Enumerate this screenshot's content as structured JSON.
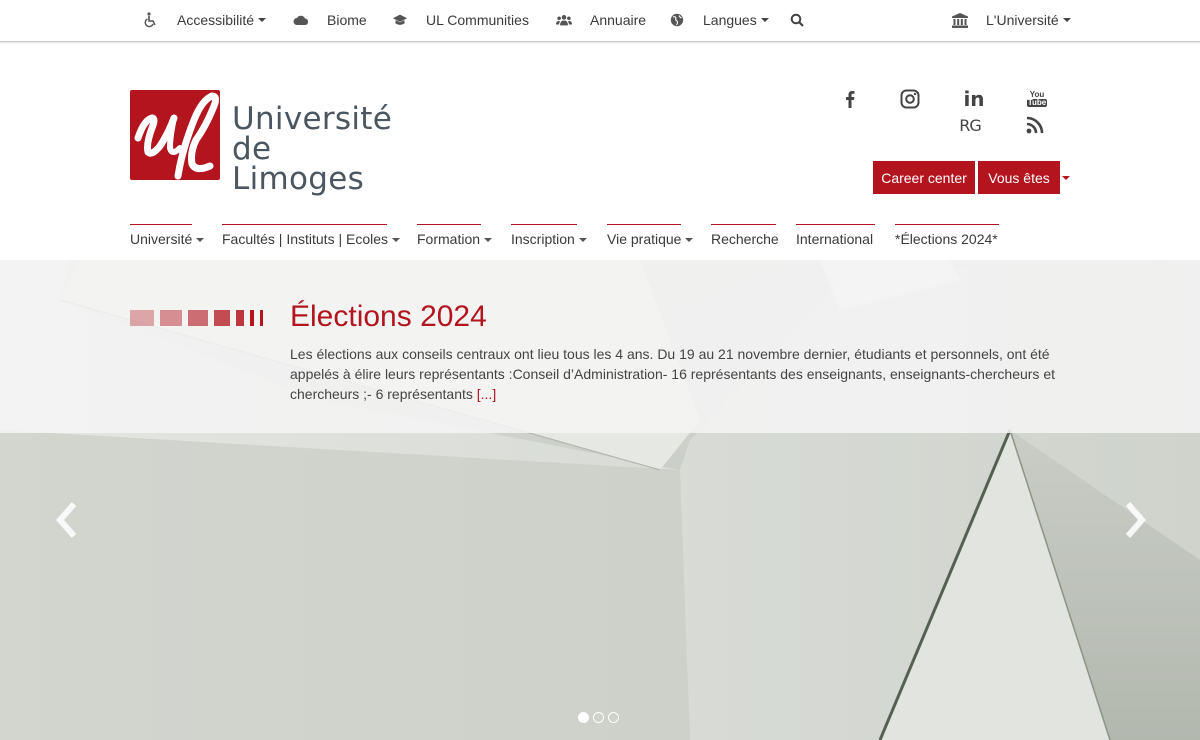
{
  "topbar": {
    "accessibility": "Accessibilité",
    "biome": "Biome",
    "communities": "UL Communities",
    "annuaire": "Annuaire",
    "langues": "Langues",
    "universite": "L'Université"
  },
  "logo": {
    "line1": "Université",
    "line2": "de Limoges"
  },
  "social": {
    "facebook": "f",
    "linkedin": "in",
    "youtube_top": "You",
    "youtube_bottom": "Tube",
    "researchgate": "RG"
  },
  "buttons": {
    "career": "Career center",
    "vous_etes": "Vous êtes"
  },
  "nav": {
    "items": [
      {
        "label": "Université",
        "dropdown": true
      },
      {
        "label": "Facultés | Instituts | Ecoles",
        "dropdown": true
      },
      {
        "label": "Formation",
        "dropdown": true
      },
      {
        "label": "Inscription",
        "dropdown": true
      },
      {
        "label": "Vie pratique",
        "dropdown": true
      },
      {
        "label": "Recherche",
        "dropdown": false
      },
      {
        "label": "International",
        "dropdown": false
      },
      {
        "label": "*Élections 2024*",
        "dropdown": false
      }
    ]
  },
  "hero": {
    "title": "Élections 2024",
    "text": "Les élections aux conseils centraux ont lieu tous les 4 ans. Du 19 au 21 novembre dernier, étudiants et personnels, ont été appelés à élire leurs représentants :Conseil d’Administration- 16 représentants des enseignants, enseignants-chercheurs et chercheurs  ;- 6 représentants ",
    "more": "[...]",
    "slides": 3,
    "active_slide": 1
  },
  "colors": {
    "brand": "#b3141e",
    "text": "#3a3a3a",
    "logo_text": "#4b5660"
  }
}
